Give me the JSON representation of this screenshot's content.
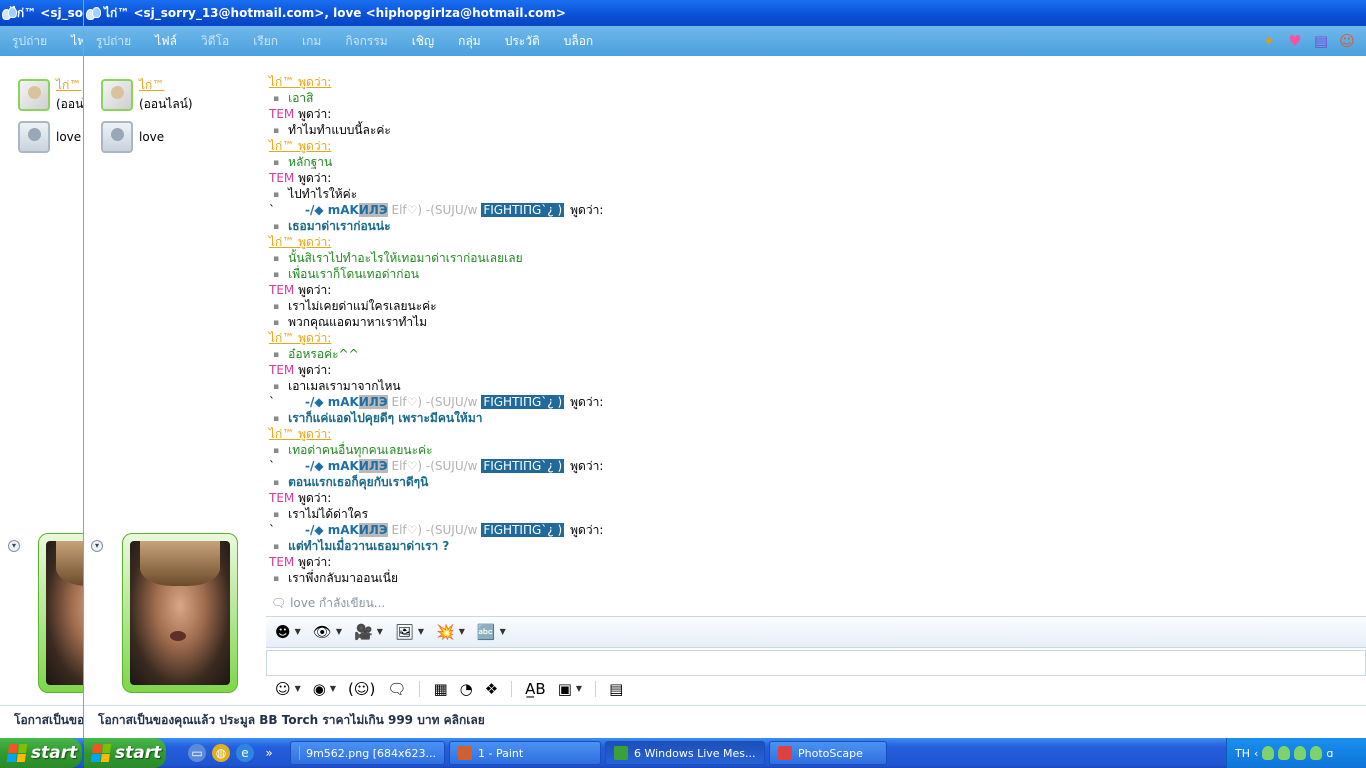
{
  "back_window": {
    "title": "ไก่™ <sj_so",
    "menu": [
      "รูปถ่าย",
      "ไฟ"
    ],
    "contacts": [
      {
        "name": "ไก่™",
        "status": "(ออนไ"
      },
      {
        "name": "love"
      }
    ],
    "footer": "โอกาสเป็นขอ"
  },
  "front_window": {
    "title": "ไก่™ <sj_sorry_13@hotmail.com>, love <hiphopgirlza@hotmail.com>",
    "menu": [
      {
        "label": "รูปถ่าย",
        "dim": true
      },
      {
        "label": "ไฟล์",
        "dim": false
      },
      {
        "label": "วิดีโอ",
        "dim": true
      },
      {
        "label": "เรียก",
        "dim": true
      },
      {
        "label": "เกม",
        "dim": true
      },
      {
        "label": "กิจกรรม",
        "dim": true
      },
      {
        "label": "เชิญ",
        "dim": false
      },
      {
        "label": "กลุ่ม",
        "dim": false
      },
      {
        "label": "ประวัติ",
        "dim": false
      },
      {
        "label": "บล็อก",
        "dim": false
      }
    ],
    "contacts": [
      {
        "name": "ไก่™",
        "status": "(ออนไลน์)"
      },
      {
        "name": "love"
      }
    ],
    "footer": "โอกาสเป็นของคุณแล้ว ประมูล BB Torch ราคาไม่เกิน 999 บาท คลิกเลย",
    "typing_status": "love กำลังเขียน..."
  },
  "chat": {
    "said": "พูดว่า:",
    "mak": {
      "tick": "`",
      "prefix": "-/◆ mAK",
      "hl": "ИЛЭ",
      "grey": " Elf♡) -(SUJU/w ",
      "fight": "FIGHTIΠG`¿ )"
    },
    "lines": [
      {
        "t": "ky"
      },
      {
        "t": "ky-msg",
        "text": "เอาสิ"
      },
      {
        "t": "tem"
      },
      {
        "t": "tem-msg",
        "text": "ทำไมทำแบบนี้ละค่ะ"
      },
      {
        "t": "ky"
      },
      {
        "t": "ky-msg",
        "text": "หลักฐาน"
      },
      {
        "t": "tem"
      },
      {
        "t": "tem-msg",
        "text": "ไปทำไรให้ค่ะ"
      },
      {
        "t": "mak"
      },
      {
        "t": "mak-msg",
        "text": "เธอมาด่าเราก่อนน่ะ"
      },
      {
        "t": "ky"
      },
      {
        "t": "ky-msg",
        "text": "นั้นสิเราไปทำอะไรให้เทอมาด่าเราก่อนเลยเลย"
      },
      {
        "t": "ky-msg",
        "text": "เพื่อนเราก็โดนเทอด่าก่อน"
      },
      {
        "t": "tem"
      },
      {
        "t": "tem-msg",
        "text": "เราไม่เคยด่าแม่ใครเลยนะค่ะ"
      },
      {
        "t": "tem-msg",
        "text": "พวกคุณแอดมาหาเราทำไม"
      },
      {
        "t": "ky"
      },
      {
        "t": "ky-msg",
        "text": "อ๋อหรอค่ะ^^"
      },
      {
        "t": "tem"
      },
      {
        "t": "tem-msg",
        "text": "เอาเมลเรามาจากไหน"
      },
      {
        "t": "mak"
      },
      {
        "t": "mak-msg",
        "text": "เราก็แค่แอดไปคุยดีๆ เพราะมีคนให้มา"
      },
      {
        "t": "ky"
      },
      {
        "t": "ky-msg",
        "text": "เทอด่าคนอื่นทุกคนเลยนะค่ะ"
      },
      {
        "t": "mak"
      },
      {
        "t": "mak-msg",
        "text": "ตอนแรกเธอก็คุยกับเราดีๆนิ"
      },
      {
        "t": "tem"
      },
      {
        "t": "tem-msg",
        "text": "เราไม่ได้ด่าใคร"
      },
      {
        "t": "mak"
      },
      {
        "t": "mak-msg",
        "text": "แต่ทำไมเมื่อวานเธอมาด่าเรา ?"
      },
      {
        "t": "tem"
      },
      {
        "t": "tem-msg",
        "text": "เราพึ่งกลับมาออนเนี่ย"
      }
    ],
    "ky_name": "ไก่™",
    "tem_name": "TEM"
  },
  "taskbar": {
    "start_label": "start",
    "tasks": [
      {
        "label": "9m562.png [684x623...",
        "active": false,
        "color": "#e0a020"
      },
      {
        "label": "1 - Paint",
        "active": false,
        "color": "#d06030"
      },
      {
        "label": "6 Windows Live Mes...",
        "active": true,
        "color": "#3aa03a"
      },
      {
        "label": "PhotoScape",
        "active": false,
        "color": "#e04040"
      }
    ],
    "language": "TH",
    "overflow": "»"
  },
  "colors": {
    "titlebar": "#0a4fd6",
    "menubar": "#4aa0de",
    "ky": "#e8a317",
    "tem": "#d63a9e",
    "mak": "#1e6fa8"
  }
}
